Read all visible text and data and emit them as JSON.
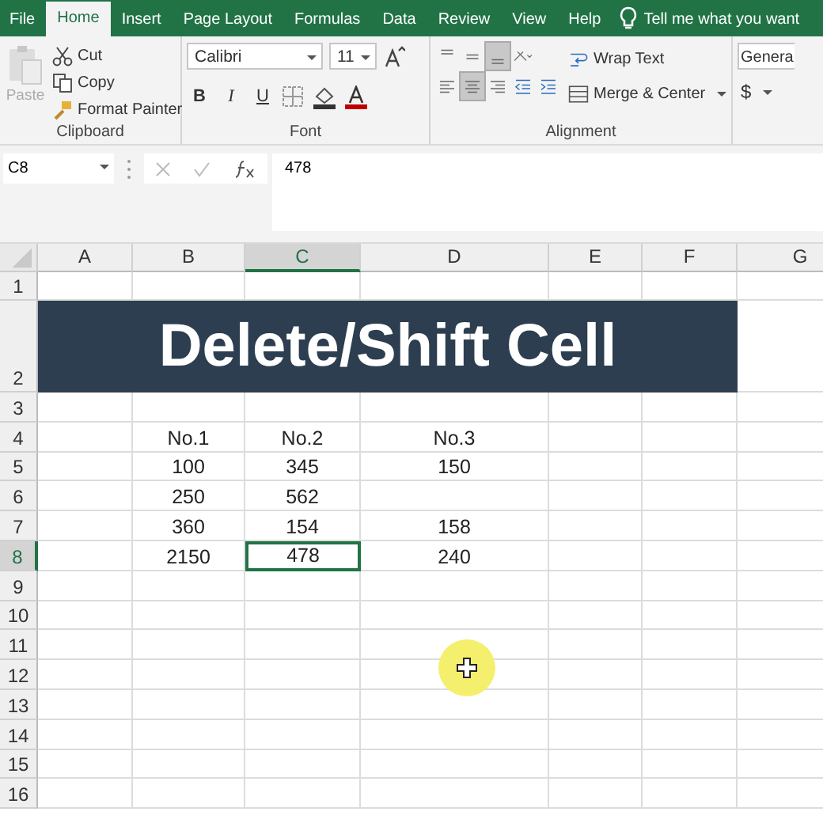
{
  "tabs": [
    {
      "label": "File",
      "selected": false
    },
    {
      "label": "Home",
      "selected": true
    },
    {
      "label": "Insert",
      "selected": false
    },
    {
      "label": "Page Layout",
      "selected": false
    },
    {
      "label": "Formulas",
      "selected": false
    },
    {
      "label": "Data",
      "selected": false
    },
    {
      "label": "Review",
      "selected": false
    },
    {
      "label": "View",
      "selected": false
    },
    {
      "label": "Help",
      "selected": false
    }
  ],
  "tell_me": {
    "placeholder": "Tell me what you want"
  },
  "clipboard": {
    "paste": {
      "label": "Paste",
      "disabled": true
    },
    "cut": "Cut",
    "copy": "Copy",
    "format_painter": "Format Painter",
    "label": "Clipboard"
  },
  "font": {
    "name": "Calibri",
    "size": "11",
    "bold": "B",
    "italic": "I",
    "underline": "U",
    "label": "Font"
  },
  "alignment": {
    "vertical": [
      {
        "selected": false
      },
      {
        "selected": false
      },
      {
        "selected": true
      }
    ],
    "horizontal": [
      {
        "selected": false
      },
      {
        "selected": true
      },
      {
        "selected": false
      }
    ],
    "wrap_text": "Wrap Text",
    "merge_center": "Merge & Center",
    "label": "Alignment"
  },
  "number": {
    "format": "Genera",
    "currency": "$"
  },
  "name_box": "C8",
  "formula": "478",
  "columns": [
    {
      "label": "A",
      "selected": false
    },
    {
      "label": "B",
      "selected": false
    },
    {
      "label": "C",
      "selected": true
    },
    {
      "label": "D",
      "selected": false
    },
    {
      "label": "E",
      "selected": false
    },
    {
      "label": "F",
      "selected": false
    },
    {
      "label": "G",
      "selected": false
    }
  ],
  "rows": [
    {
      "label": "1",
      "kind": "data",
      "selected": false,
      "cells": [
        "",
        "",
        "",
        "",
        "",
        "",
        ""
      ]
    },
    {
      "label": "2",
      "kind": "banner",
      "selected": false,
      "banner": "Delete/Shift Cell"
    },
    {
      "label": "3",
      "kind": "data",
      "selected": false,
      "cells": [
        "",
        "",
        "",
        "",
        "",
        "",
        ""
      ]
    },
    {
      "label": "4",
      "kind": "data",
      "selected": false,
      "cells": [
        "",
        "No.1",
        "No.2",
        "No.3",
        "",
        "",
        ""
      ]
    },
    {
      "label": "5",
      "kind": "data",
      "selected": false,
      "cells": [
        "",
        "100",
        "345",
        "150",
        "",
        "",
        ""
      ]
    },
    {
      "label": "6",
      "kind": "data",
      "selected": false,
      "cells": [
        "",
        "250",
        "562",
        "",
        "",
        "",
        ""
      ]
    },
    {
      "label": "7",
      "kind": "data",
      "selected": false,
      "cells": [
        "",
        "360",
        "154",
        "158",
        "",
        "",
        ""
      ]
    },
    {
      "label": "8",
      "kind": "data",
      "selected": true,
      "cells": [
        "",
        "2150",
        "478",
        "240",
        "",
        "",
        ""
      ]
    },
    {
      "label": "9",
      "kind": "data",
      "selected": false,
      "cells": [
        "",
        "",
        "",
        "",
        "",
        "",
        ""
      ]
    },
    {
      "label": "10",
      "kind": "data",
      "selected": false,
      "cells": [
        "",
        "",
        "",
        "",
        "",
        "",
        ""
      ]
    },
    {
      "label": "11",
      "kind": "data",
      "selected": false,
      "cells": [
        "",
        "",
        "",
        "",
        "",
        "",
        ""
      ]
    },
    {
      "label": "12",
      "kind": "data",
      "selected": false,
      "cells": [
        "",
        "",
        "",
        "",
        "",
        "",
        ""
      ]
    },
    {
      "label": "13",
      "kind": "data",
      "selected": false,
      "cells": [
        "",
        "",
        "",
        "",
        "",
        "",
        ""
      ]
    },
    {
      "label": "14",
      "kind": "data",
      "selected": false,
      "cells": [
        "",
        "",
        "",
        "",
        "",
        "",
        ""
      ]
    },
    {
      "label": "15",
      "kind": "data",
      "selected": false,
      "cells": [
        "",
        "",
        "",
        "",
        "",
        "",
        ""
      ]
    },
    {
      "label": "16",
      "kind": "data",
      "selected": false,
      "cells": [
        "",
        "",
        "",
        "",
        "",
        "",
        ""
      ]
    }
  ]
}
